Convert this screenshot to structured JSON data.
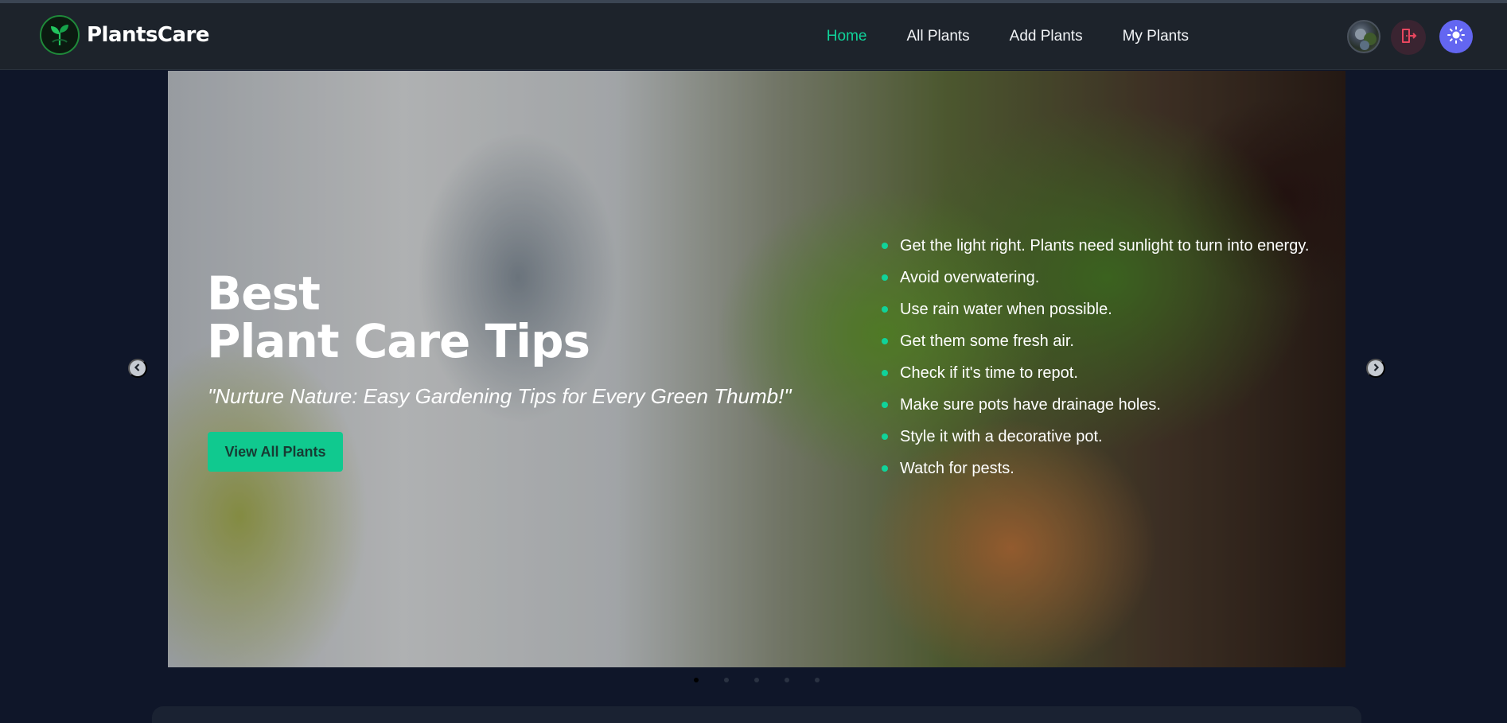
{
  "brand": {
    "name": "PlantsCare",
    "logo_icon": "leaf-sprout-icon"
  },
  "nav": {
    "items": [
      {
        "label": "Home",
        "active": true
      },
      {
        "label": "All Plants",
        "active": false
      },
      {
        "label": "Add Plants",
        "active": false
      },
      {
        "label": "My Plants",
        "active": false
      }
    ]
  },
  "header_actions": {
    "avatar_alt": "User avatar",
    "logout_icon": "logout-icon",
    "theme_icon": "sun-icon"
  },
  "hero": {
    "title_line1": "Best",
    "title_line2": "Plant Care Tips",
    "subtitle": "\"Nurture Nature: Easy Gardening Tips for Every Green Thumb!\"",
    "cta_label": "View All Plants",
    "tips": [
      "Get the light right. Plants need sunlight to turn into energy.",
      "Avoid overwatering.",
      "Use rain water when possible.",
      "Get them some fresh air.",
      "Check if it's time to repot.",
      "Make sure pots have drainage holes.",
      "Style it with a decorative pot.",
      "Watch for pests."
    ]
  },
  "carousel": {
    "slide_count": 5,
    "active_index": 0
  },
  "colors": {
    "accent": "#10d39a",
    "button": "#10c98f",
    "theme_button": "#6366f1",
    "logout": "#e8475f"
  }
}
